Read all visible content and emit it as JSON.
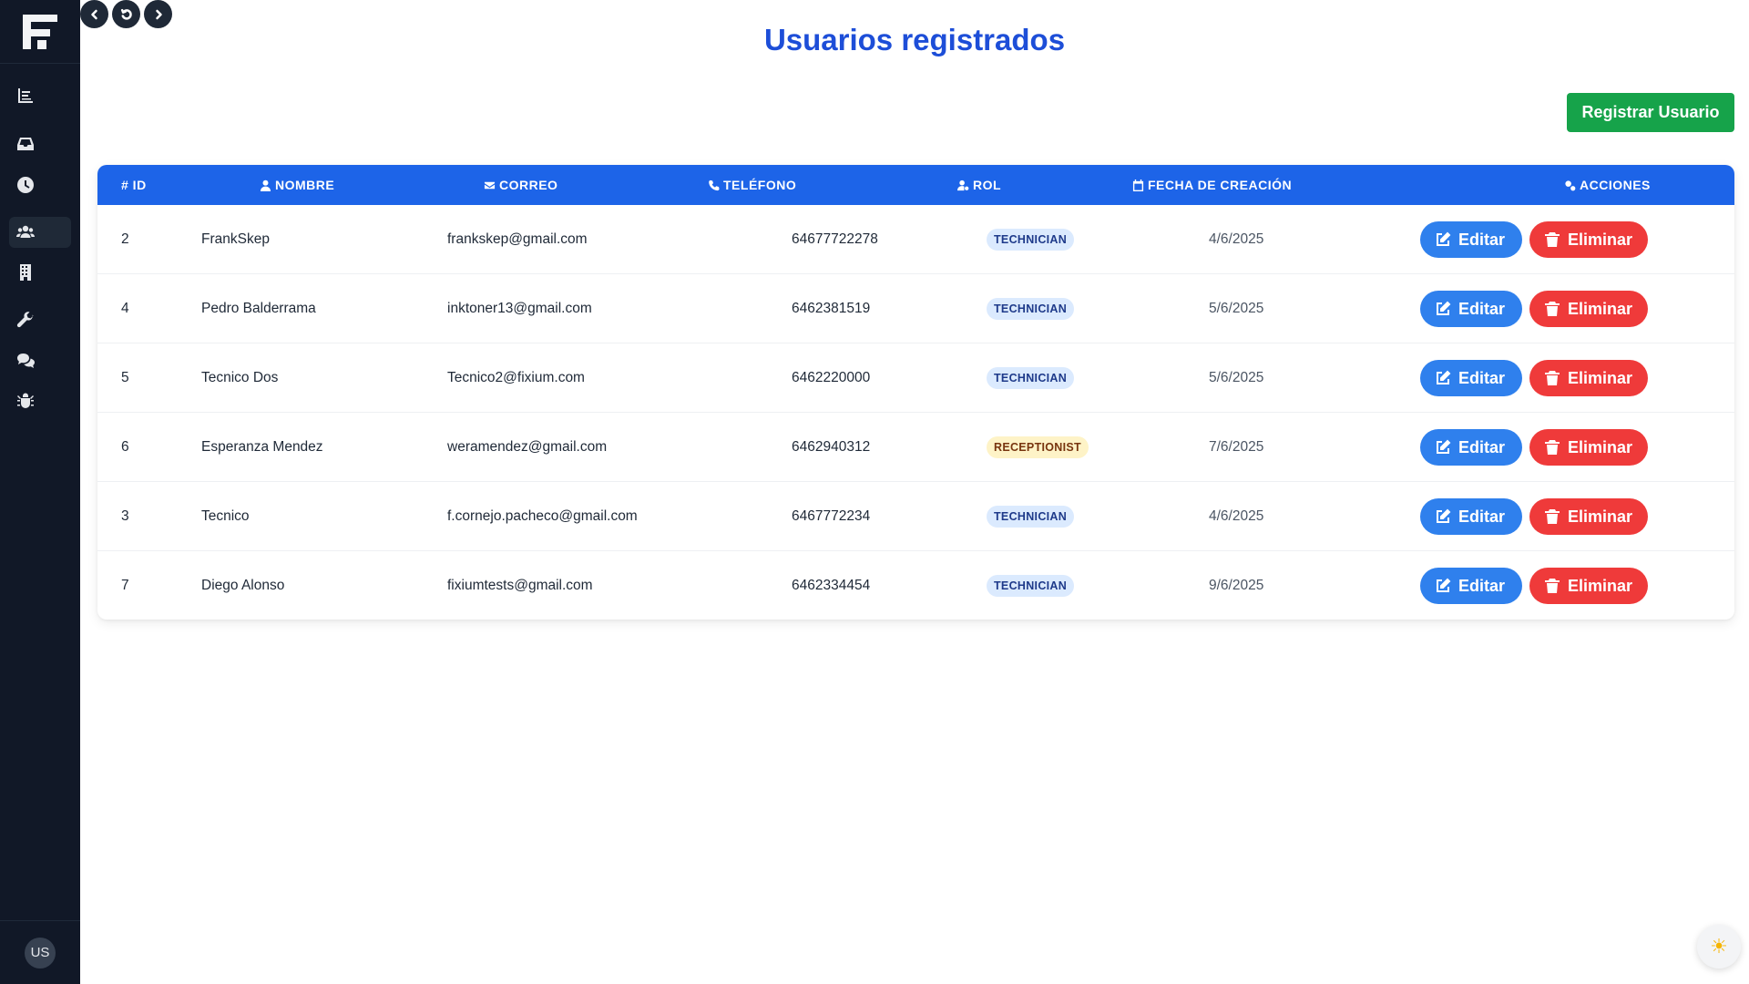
{
  "page": {
    "title": "Usuarios registrados",
    "register_label": "Registrar Usuario",
    "theme_toggle_icon": "☀"
  },
  "sidebar": {
    "items": [
      {
        "name": "dashboard",
        "icon": "chart-icon"
      },
      {
        "name": "inbox",
        "icon": "inbox-icon"
      },
      {
        "name": "history",
        "icon": "clock-icon"
      },
      {
        "name": "users",
        "icon": "users-icon",
        "active": true
      },
      {
        "name": "buildings",
        "icon": "building-icon"
      },
      {
        "name": "tools",
        "icon": "wrench-icon"
      },
      {
        "name": "chat",
        "icon": "comments-icon"
      },
      {
        "name": "bugs",
        "icon": "bug-icon"
      }
    ],
    "user_initials": "US"
  },
  "table": {
    "columns": {
      "id": "# ID",
      "name": "NOMBRE",
      "email": "CORREO",
      "phone": "TELÉFONO",
      "role": "ROL",
      "created": "FECHA DE CREACIÓN",
      "actions": "ACCIONES"
    },
    "edit_label": "Editar",
    "delete_label": "Eliminar",
    "rows": [
      {
        "id": "2",
        "name": "FrankSkep",
        "email": "frankskep@gmail.com",
        "phone": "64677722278",
        "role": "TECHNICIAN",
        "date": "4/6/2025"
      },
      {
        "id": "4",
        "name": "Pedro Balderrama",
        "email": "inktoner13@gmail.com",
        "phone": "6462381519",
        "role": "TECHNICIAN",
        "date": "5/6/2025"
      },
      {
        "id": "5",
        "name": "Tecnico Dos",
        "email": "Tecnico2@fixium.com",
        "phone": "6462220000",
        "role": "TECHNICIAN",
        "date": "5/6/2025"
      },
      {
        "id": "6",
        "name": "Esperanza Mendez",
        "email": "weramendez@gmail.com",
        "phone": "6462940312",
        "role": "RECEPTIONIST",
        "date": "7/6/2025"
      },
      {
        "id": "3",
        "name": "Tecnico",
        "email": "f.cornejo.pacheco@gmail.com",
        "phone": "6467772234",
        "role": "TECHNICIAN",
        "date": "4/6/2025"
      },
      {
        "id": "7",
        "name": "Diego Alonso",
        "email": "fixiumtests@gmail.com",
        "phone": "6462334454",
        "role": "TECHNICIAN",
        "date": "9/6/2025"
      }
    ]
  },
  "colors": {
    "sidebar": "#111827",
    "title": "#1d4ed8",
    "header": "#1d64e8",
    "register": "#16a34a",
    "edit": "#2f80ed",
    "delete": "#ef3a3a"
  }
}
